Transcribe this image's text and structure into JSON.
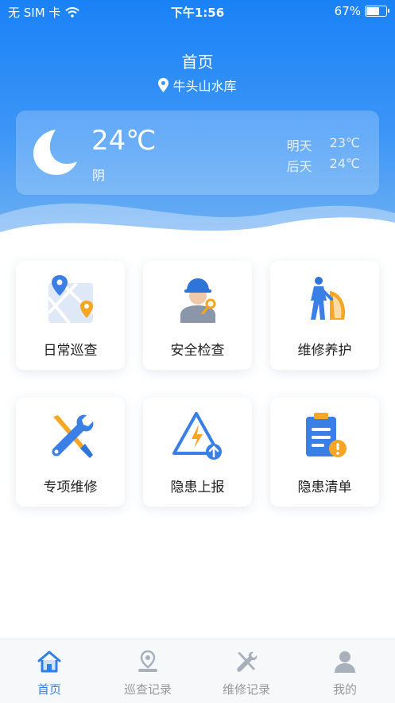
{
  "status_bar": {
    "carrier": "无 SIM 卡",
    "time": "下午1:56",
    "battery": "67%"
  },
  "header": {
    "title": "首页",
    "location": "牛头山水库"
  },
  "weather": {
    "temperature": "24℃",
    "condition": "阴",
    "forecast": [
      {
        "day": "明天",
        "temp": "23℃"
      },
      {
        "day": "后天",
        "temp": "24℃"
      }
    ]
  },
  "menu": [
    {
      "label": "日常巡查",
      "icon": "map-pin-icon"
    },
    {
      "label": "安全检查",
      "icon": "worker-icon"
    },
    {
      "label": "维修养护",
      "icon": "maintenance-worker-icon"
    },
    {
      "label": "专项维修",
      "icon": "wrench-screwdriver-icon"
    },
    {
      "label": "隐患上报",
      "icon": "warning-upload-icon"
    },
    {
      "label": "隐患清单",
      "icon": "clipboard-alert-icon"
    }
  ],
  "tabbar": [
    {
      "label": "首页",
      "icon": "home-icon",
      "active": true
    },
    {
      "label": "巡查记录",
      "icon": "location-record-icon",
      "active": false
    },
    {
      "label": "维修记录",
      "icon": "tools-icon",
      "active": false
    },
    {
      "label": "我的",
      "icon": "user-icon",
      "active": false
    }
  ],
  "colors": {
    "primary": "#1a82f7",
    "accent_orange": "#f5a623",
    "tab_active": "#2f7fe8",
    "tab_inactive": "#999999"
  }
}
